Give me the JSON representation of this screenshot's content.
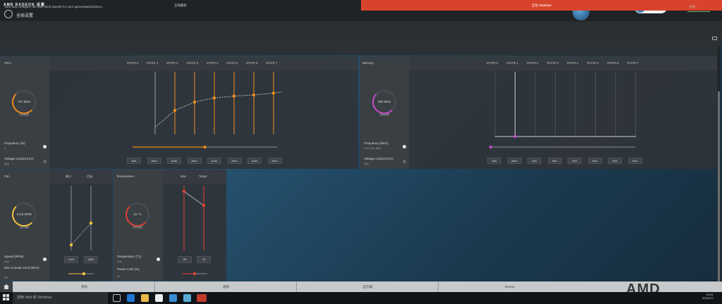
{
  "window": {
    "brand_amd": "AMD",
    "brand_radeon": "RADEON 设置",
    "page_title": "全局设置",
    "cpu_badge_top": "...",
    "cpu_badge_bottom": "CPU温度"
  },
  "tabs": [
    {
      "label": "全局图形"
    },
    {
      "label": "全局 WattMan"
    }
  ],
  "info": {
    "text": "View and configure fan and clock speeds for your games/applications...",
    "more": "更多..."
  },
  "gpu": {
    "title": "GPU",
    "states": [
      "STATE 0",
      "STATE 1",
      "STATE 2",
      "STATE 3",
      "STATE 4",
      "STATE 5",
      "STATE 6",
      "STATE 7"
    ],
    "gauge_value": "727 MHz",
    "gauge_caption": "当前速度",
    "freq_label": "Frequency (%)",
    "freq_value": "0",
    "volt_label": "Voltage Control (mV)",
    "volt_value": "自动",
    "volt_values": [
      "N/A",
      "Auto",
      "Auto",
      "Auto",
      "Auto",
      "Auto",
      "Auto",
      "Auto"
    ],
    "curve": [
      0.12,
      0.4,
      0.54,
      0.61,
      0.64,
      0.66,
      0.69,
      0.73
    ],
    "slider": 0.5,
    "color": "#f08a1c"
  },
  "memory": {
    "title": "Memory",
    "states": [
      "STATE 0",
      "STATE 1",
      "STATE 2",
      "STATE 3",
      "STATE 4",
      "STATE 5",
      "STATE 6",
      "STATE 7"
    ],
    "gauge_value": "300 MHz",
    "gauge_caption": "当前速度",
    "freq_label": "Frequency (MHz)",
    "freq_value": "2000 MHz 电流",
    "volt_label": "Voltage Control (mV)",
    "volt_value": "自动",
    "volt_values": [
      "N/A",
      "Auto",
      "N/A",
      "N/A",
      "N/A",
      "N/A",
      "N/A",
      "N/A"
    ],
    "color": "#c64bc9"
  },
  "fan": {
    "title": "Fan",
    "col_min": "最小",
    "col_target": "目标",
    "gauge_value": "1718 RPM",
    "gauge_caption": "当前速度",
    "speed_label": "Speed (RPM)",
    "speed_value": "手动",
    "min_label": "Min Acoustic Limit (MHz)",
    "min_value": "800",
    "min_box": "1400",
    "target_box": "2800",
    "color": "#f3c43a"
  },
  "temperature": {
    "title": "Temperature",
    "col_max": "Max",
    "col_target": "Target",
    "gauge_value": "31 °C",
    "gauge_caption": "当前温度",
    "temp_label": "Temperature (°C)",
    "temp_value": "手动",
    "power_label": "Power Limit (%)",
    "power_value": "15",
    "max_box": "85",
    "target_box": "75",
    "color": "#e2412f"
  },
  "bottom_nav": [
    {
      "label": "游戏"
    },
    {
      "label": "视频"
    },
    {
      "label": "显示器"
    },
    {
      "label": "ReLive"
    }
  ],
  "taskbar": {
    "search": "搜索 Web 和 Windows",
    "time": "10:01",
    "date": "2016/7/2"
  },
  "watermark": "AMD"
}
